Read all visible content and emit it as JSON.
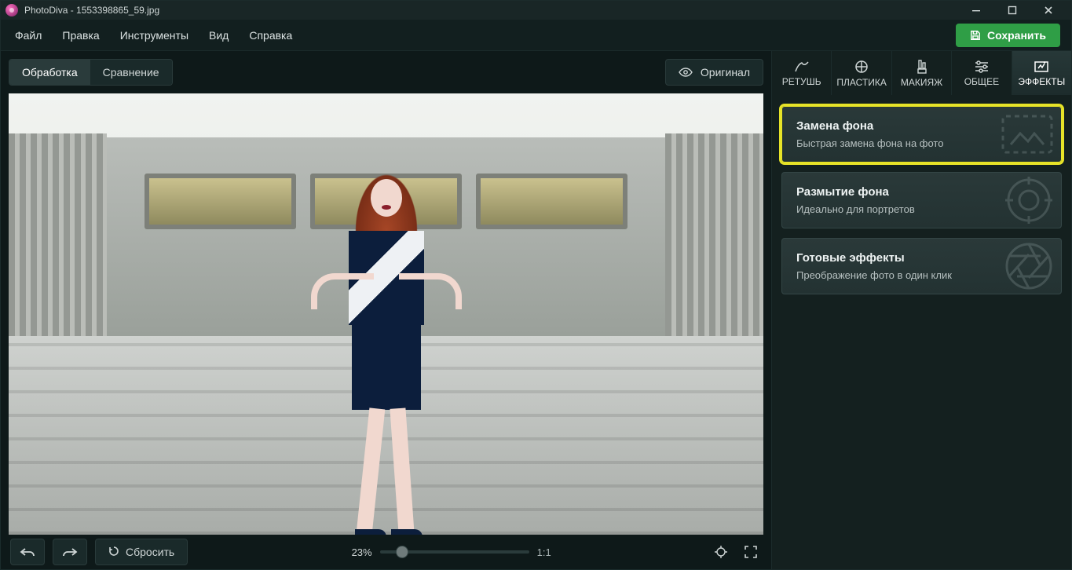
{
  "titlebar": {
    "title": "PhotoDiva - 1553398865_59.jpg"
  },
  "menu": {
    "items": [
      "Файл",
      "Правка",
      "Инструменты",
      "Вид",
      "Справка"
    ]
  },
  "save_label": "Сохранить",
  "workspace": {
    "tabs": {
      "edit": "Обработка",
      "compare": "Сравнение"
    },
    "original_btn": "Оригинал",
    "reset_btn": "Сбросить",
    "zoom_percent": "23%",
    "zoom_fixed": "1:1"
  },
  "right_tabs": [
    {
      "id": "retouch",
      "label": "РЕТУШЬ"
    },
    {
      "id": "plastica",
      "label": "ПЛАСТИКА"
    },
    {
      "id": "makeup",
      "label": "МАКИЯЖ"
    },
    {
      "id": "general",
      "label": "ОБЩЕЕ"
    },
    {
      "id": "effects",
      "label": "ЭФФЕКТЫ"
    }
  ],
  "effect_cards": [
    {
      "title": "Замена фона",
      "sub": "Быстрая замена фона на фото",
      "highlight": true
    },
    {
      "title": "Размытие фона",
      "sub": "Идеально для портретов",
      "highlight": false
    },
    {
      "title": "Готовые эффекты",
      "sub": "Преображение фото в один клик",
      "highlight": false
    }
  ]
}
